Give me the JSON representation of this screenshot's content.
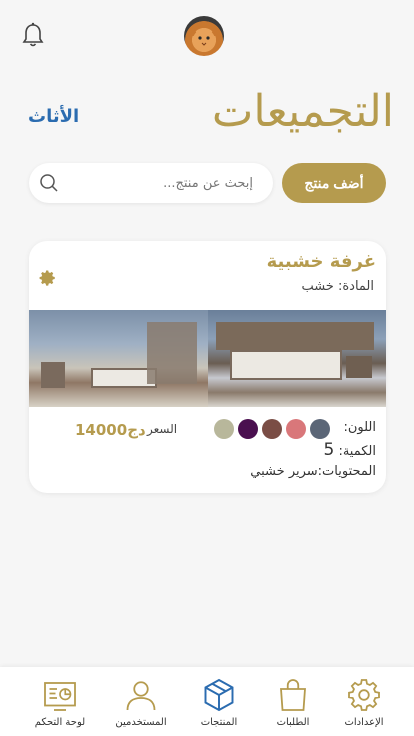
{
  "header": {
    "title": "التجميعات",
    "category": "الأثاث"
  },
  "toolbar": {
    "add_label": "أضف منتج",
    "search_placeholder": "إبحث عن منتج..."
  },
  "product": {
    "name": "غرفة خشبية",
    "material": "المادة: خشب",
    "color_label": "اللون:",
    "colors": [
      "#5b6677",
      "#d9777a",
      "#7a4d45",
      "#4a0f4f",
      "#b8b79b"
    ],
    "quantity_label": "الكمية:",
    "quantity_value": "5",
    "contents": "المحتويات:سرير خشبي",
    "price_label": "السعر",
    "price_value": "14000دج"
  },
  "nav": {
    "items": [
      {
        "label": "الإعدادات",
        "icon": "gear-icon"
      },
      {
        "label": "الطلبات",
        "icon": "shopping-bag-icon"
      },
      {
        "label": "المنتجات",
        "icon": "box-icon"
      },
      {
        "label": "المستخدمين",
        "icon": "user-icon"
      },
      {
        "label": "لوحة التحكم",
        "icon": "dashboard-icon"
      }
    ]
  }
}
